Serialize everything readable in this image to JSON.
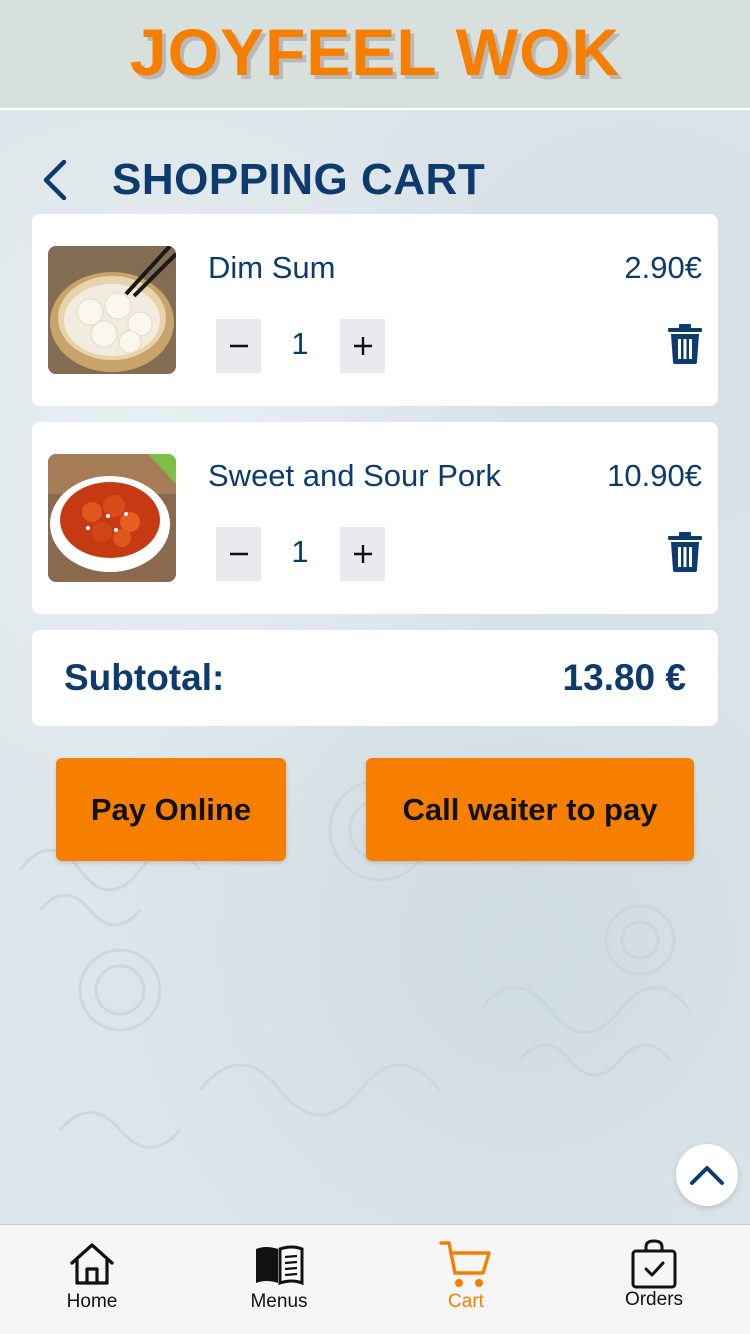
{
  "header": {
    "brand": "JOYFEEL WOK"
  },
  "page": {
    "title": "SHOPPING CART"
  },
  "cart": {
    "items": [
      {
        "name": "Dim Sum",
        "price": "2.90€",
        "quantity": "1",
        "image": "dim-sum-dish"
      },
      {
        "name": "Sweet and Sour Pork",
        "price": "10.90€",
        "quantity": "1",
        "image": "sweet-sour-pork-dish"
      }
    ],
    "subtotal_label": "Subtotal:",
    "subtotal_value": "13.80 €"
  },
  "actions": {
    "pay_online": "Pay Online",
    "call_waiter": "Call waiter to pay"
  },
  "tabbar": {
    "items": [
      {
        "label": "Home",
        "icon": "home-icon"
      },
      {
        "label": "Menus",
        "icon": "menu-book-icon"
      },
      {
        "label": "Cart",
        "icon": "cart-icon",
        "active": true
      },
      {
        "label": "Orders",
        "icon": "orders-bag-icon"
      }
    ]
  },
  "colors": {
    "accent": "#f77f00",
    "primary_text": "#0d3b6e",
    "header_bg": "#d8e0dd"
  }
}
